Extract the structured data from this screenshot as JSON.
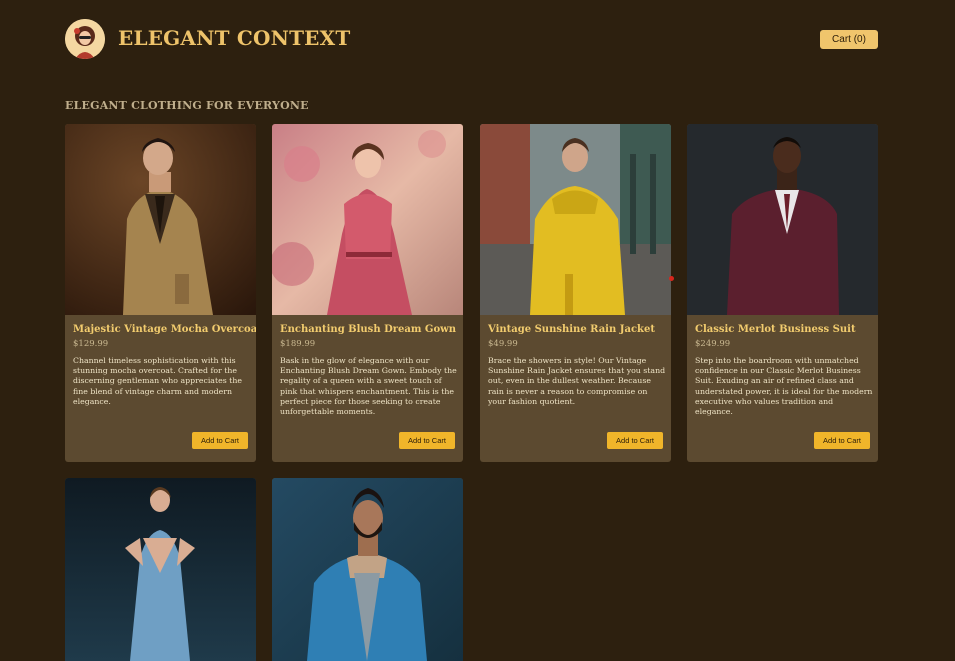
{
  "header": {
    "brand": "ELEGANT CONTEXT",
    "cart_label": "Cart (0)"
  },
  "section_title": "ELEGANT CLOTHING FOR EVERYONE",
  "add_label": "Add to Cart",
  "products": [
    {
      "name": "Majestic Vintage Mocha Overcoat",
      "price": "$129.99",
      "description": "Channel timeless sophistication with this stunning mocha overcoat. Crafted for the discerning gentleman who appreciates the fine blend of vintage charm and modern elegance."
    },
    {
      "name": "Enchanting Blush Dream Gown",
      "price": "$189.99",
      "description": "Bask in the glow of elegance with our Enchanting Blush Dream Gown. Embody the regality of a queen with a sweet touch of pink that whispers enchantment. This is the perfect piece for those seeking to create unforgettable moments."
    },
    {
      "name": "Vintage Sunshine Rain Jacket",
      "price": "$49.99",
      "description": "Brace the showers in style! Our Vintage Sunshine Rain Jacket ensures that you stand out, even in the dullest weather. Because rain is never a reason to compromise on your fashion quotient."
    },
    {
      "name": "Classic Merlot Business Suit",
      "price": "$249.99",
      "description": "Step into the boardroom with unmatched confidence in our Classic Merlot Business Suit. Exuding an air of refined class and understated power, it is ideal for the modern executive who values tradition and elegance."
    },
    {
      "name": "",
      "price": "",
      "description": ""
    },
    {
      "name": "",
      "price": "",
      "description": ""
    }
  ],
  "colors": {
    "background": "#2d200f",
    "card": "#5c4a30",
    "accent": "#f0b52a",
    "title": "#f2cc6e"
  }
}
